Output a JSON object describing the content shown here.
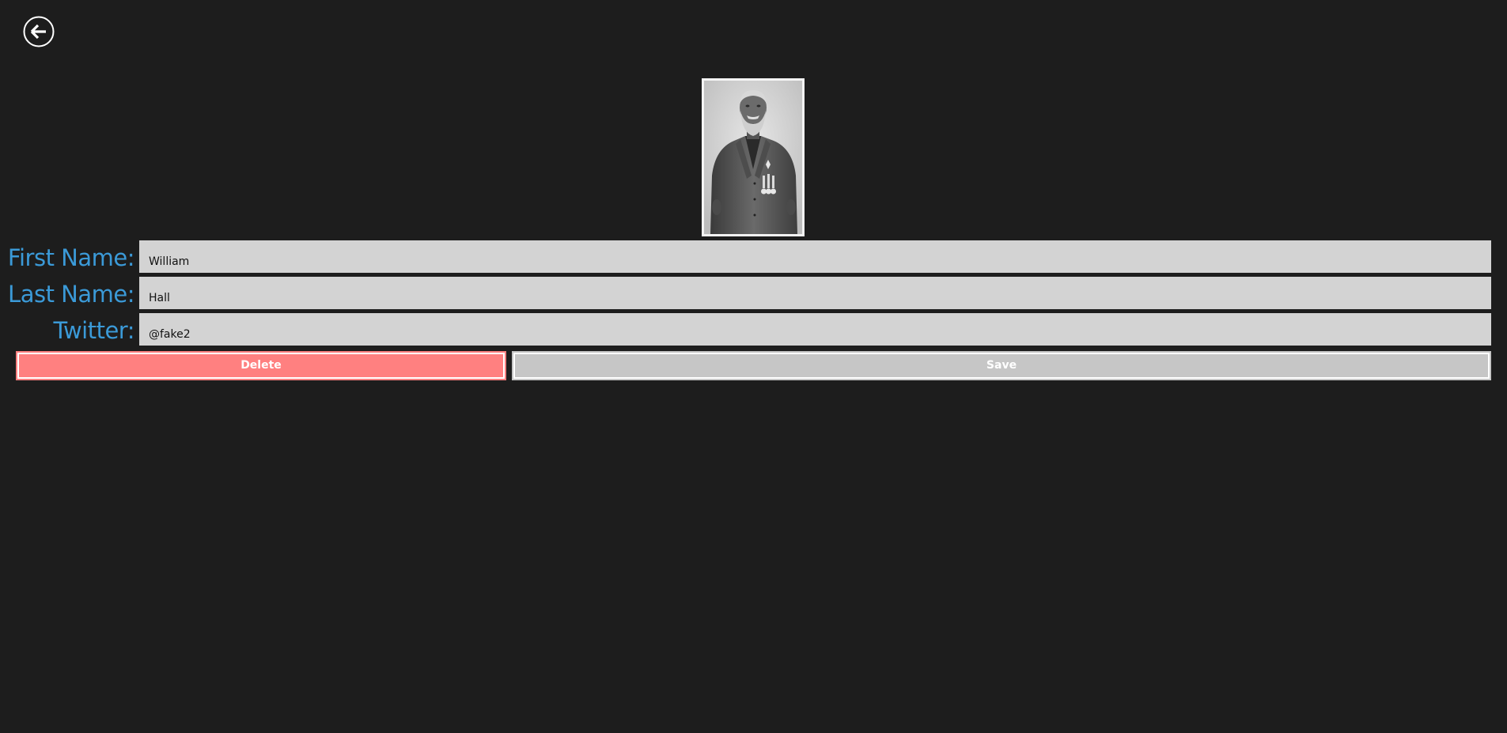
{
  "header": {
    "back_icon": "arrow-left-circle-icon"
  },
  "portrait": {
    "icon": "person-photo-icon"
  },
  "form": {
    "first_name": {
      "label": "First Name:",
      "value": "William"
    },
    "last_name": {
      "label": "Last Name:",
      "value": "Hall"
    },
    "twitter": {
      "label": "Twitter:",
      "value": "@fake2"
    }
  },
  "actions": {
    "delete_label": "Delete",
    "save_label": "Save"
  },
  "colors": {
    "background": "#1d1d1d",
    "label_accent": "#3b9ad8",
    "input_bg": "#d3d3d3",
    "delete_bg": "#ff8080",
    "save_bg": "#c6c6c6"
  }
}
